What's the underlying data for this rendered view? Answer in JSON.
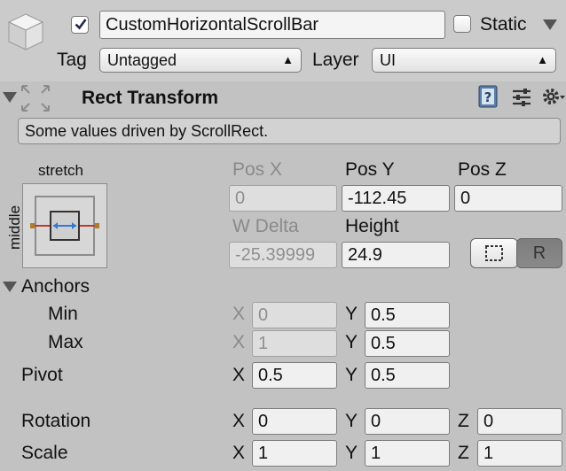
{
  "gameobject": {
    "active": true,
    "name": "CustomHorizontalScrollBar",
    "static_label": "Static",
    "static_checked": false,
    "tag_label": "Tag",
    "tag_value": "Untagged",
    "layer_label": "Layer",
    "layer_value": "UI",
    "icon": "cube-icon"
  },
  "component": {
    "title": "Rect Transform",
    "icons": [
      "help-book-icon",
      "preset-settings-icon",
      "gear-icon"
    ],
    "info": "Some values driven by ScrollRect.",
    "anchor_preset": {
      "top_label": "stretch",
      "side_label": "middle"
    },
    "columns": {
      "pos_x": {
        "label": "Pos X",
        "value": "0",
        "disabled": true
      },
      "pos_y": {
        "label": "Pos Y",
        "value": "-112.45",
        "disabled": false
      },
      "pos_z": {
        "label": "Pos Z",
        "value": "0",
        "disabled": false
      },
      "w_delta": {
        "label": "W Delta",
        "value": "-25.39999",
        "disabled": true
      },
      "height": {
        "label": "Height",
        "value": "24.9",
        "disabled": false
      }
    },
    "buttons": {
      "blueprint": "blueprint-mode-icon",
      "raw_edit": "R"
    },
    "anchors": {
      "label": "Anchors",
      "min": {
        "label": "Min",
        "x_label": "X",
        "x": "0",
        "y_label": "Y",
        "y": "0.5"
      },
      "max": {
        "label": "Max",
        "x_label": "X",
        "x": "1",
        "y_label": "Y",
        "y": "0.5"
      }
    },
    "pivot": {
      "label": "Pivot",
      "x_label": "X",
      "x": "0.5",
      "y_label": "Y",
      "y": "0.5"
    },
    "rotation": {
      "label": "Rotation",
      "x_label": "X",
      "x": "0",
      "y_label": "Y",
      "y": "0",
      "z_label": "Z",
      "z": "0"
    },
    "scale": {
      "label": "Scale",
      "x_label": "X",
      "x": "1",
      "y_label": "Y",
      "y": "1",
      "z_label": "Z",
      "z": "1"
    }
  }
}
